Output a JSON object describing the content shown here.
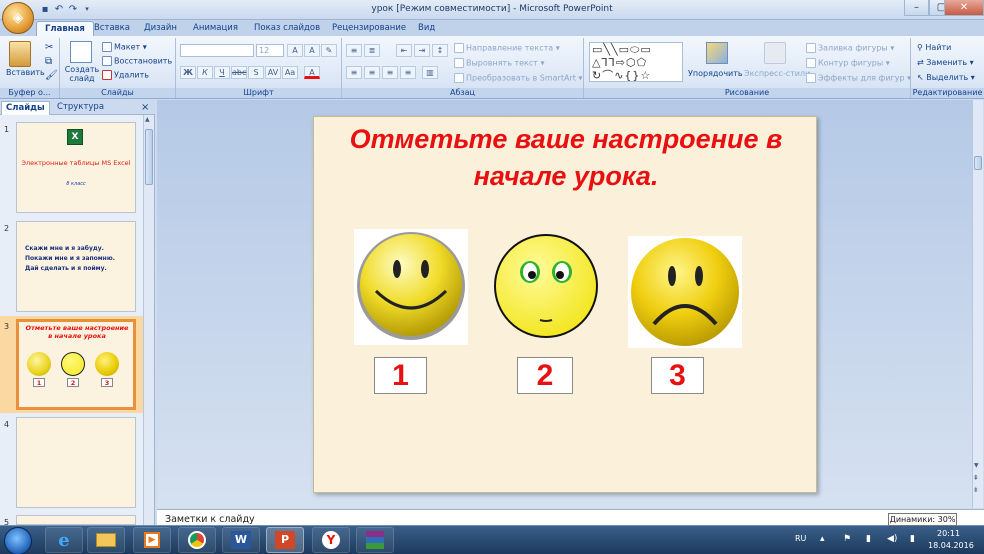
{
  "window": {
    "title": "урок [Режим совместимости] - Microsoft PowerPoint",
    "min": "–",
    "max": "▢",
    "close": "✕"
  },
  "tabs": [
    "Главная",
    "Вставка",
    "Дизайн",
    "Анимация",
    "Показ слайдов",
    "Рецензирование",
    "Вид"
  ],
  "ribbon": {
    "clipboard": {
      "paste": "Вставить",
      "label": "Буфер о..."
    },
    "slides": {
      "create": "Создать слайд",
      "layout": "Макет",
      "reset": "Восстановить",
      "delete": "Удалить",
      "label": "Слайды"
    },
    "font": {
      "size": "12",
      "label": "Шрифт"
    },
    "paragraph": {
      "text_direction": "Направление текста",
      "align_text": "Выровнять текст",
      "smartart": "Преобразовать в SmartArt",
      "label": "Абзац"
    },
    "drawing": {
      "arrange": "Упорядочить",
      "quick_styles": "Экспресс-стили",
      "fill": "Заливка фигуры",
      "outline": "Контур фигуры",
      "effects": "Эффекты для фигур",
      "label": "Рисование"
    },
    "editing": {
      "find": "Найти",
      "replace": "Заменить",
      "select": "Выделить",
      "label": "Редактирование"
    }
  },
  "pane": {
    "tab_slides": "Слайды",
    "tab_outline": "Структура",
    "close": "×",
    "thumbs": [
      {
        "num": "1",
        "title": "Электронные таблицы MS Excel",
        "sub": "8 класс"
      },
      {
        "num": "2",
        "lines": [
          "Скажи мне и я забуду.",
          "Покажи мне и я запомню.",
          "Дай сделать и я пойму."
        ]
      },
      {
        "num": "3",
        "title": "Отметьте ваше настроение в начале урока",
        "n1": "1",
        "n2": "2",
        "n3": "3"
      },
      {
        "num": "4"
      },
      {
        "num": "5"
      }
    ]
  },
  "slide": {
    "title": "Отметьте ваше настроение в начале урока.",
    "box1": "1",
    "box2": "2",
    "box3": "3"
  },
  "notes": "Заметки к слайду",
  "tooltip": "Динамики: 30%",
  "tray": {
    "lang": "RU",
    "time": "20:11",
    "date": "18.04.2016"
  },
  "colors": {
    "title_red": "#e81010",
    "slide_bg": "#fbf1db",
    "selection": "#e8913c"
  }
}
